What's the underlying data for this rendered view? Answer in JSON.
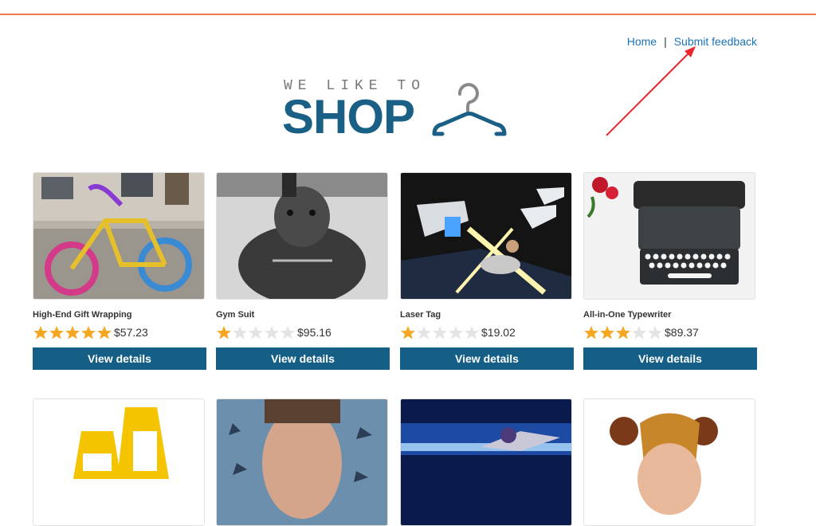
{
  "nav": {
    "home_label": "Home",
    "separator": "|",
    "feedback_label": "Submit feedback"
  },
  "logo": {
    "tagline": "WE LIKE TO",
    "brand": "SHOP"
  },
  "annotation": {
    "color": "#e8262b"
  },
  "colors": {
    "accent_rule": "#f07a4a",
    "brand": "#1a5f86",
    "button": "#155f86",
    "link": "#1a73b8",
    "star": "#f5a623",
    "star_empty": "#e4e4e4"
  },
  "products": [
    {
      "name": "High-End Gift Wrapping",
      "rating": 5,
      "price": "$57.23",
      "button": "View details",
      "image": "knitted-bicycle-photo"
    },
    {
      "name": "Gym Suit",
      "rating": 1,
      "price": "$95.16",
      "button": "View details",
      "image": "muscle-dog-photo"
    },
    {
      "name": "Laser Tag",
      "rating": 1,
      "price": "$19.02",
      "button": "View details",
      "image": "laser-tag-photo"
    },
    {
      "name": "All-in-One Typewriter",
      "rating": 3,
      "price": "$89.37",
      "button": "View details",
      "image": "typewriter-photo"
    },
    {
      "name": "",
      "rating": null,
      "price": "",
      "button": "",
      "image": "caution-signs-photo"
    },
    {
      "name": "",
      "rating": null,
      "price": "",
      "button": "",
      "image": "grimacing-man-photo"
    },
    {
      "name": "",
      "rating": null,
      "price": "",
      "button": "",
      "image": "flying-superhero-photo"
    },
    {
      "name": "",
      "rating": null,
      "price": "",
      "button": "",
      "image": "pud-head-hat-photo"
    }
  ]
}
